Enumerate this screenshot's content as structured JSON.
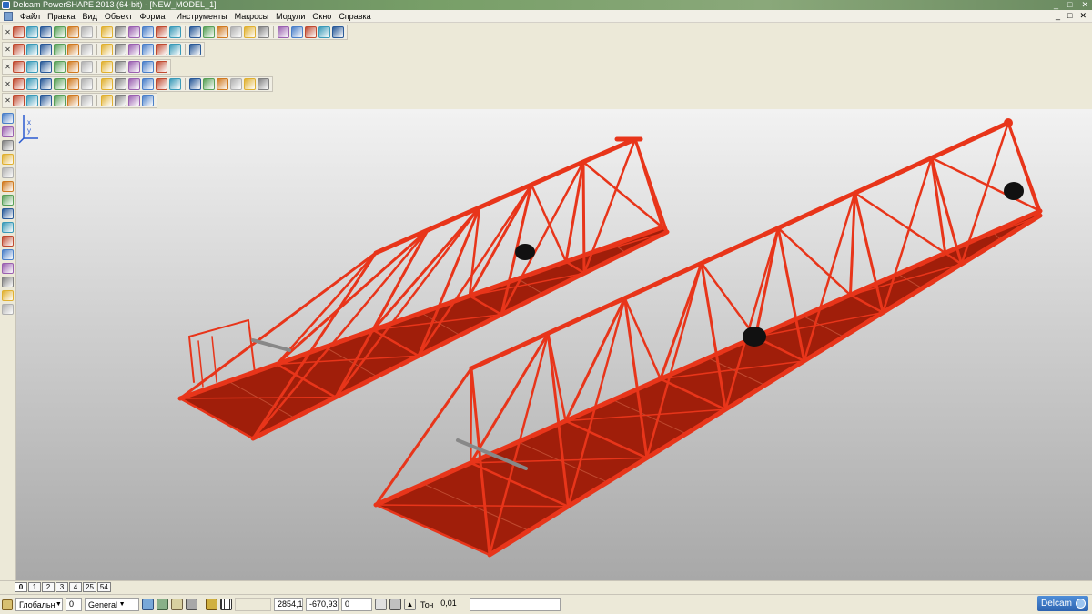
{
  "window": {
    "title": "Delcam PowerSHAPE 2013 (64-bit) - [NEW_MODEL_1]",
    "controls": [
      "_",
      "□",
      "✕"
    ]
  },
  "menubar": {
    "items": [
      "Файл",
      "Правка",
      "Вид",
      "Объект",
      "Формат",
      "Инструменты",
      "Макросы",
      "Модули",
      "Окно",
      "Справка"
    ],
    "mdi_controls": [
      "_",
      "□",
      "✕"
    ]
  },
  "toolbars": {
    "row1_icons": [
      "open-icon",
      "folder-icon",
      "save-icon",
      "print-icon",
      "disk-icon",
      "cut-icon",
      "copy-icon",
      "paste-icon",
      "delete-icon",
      "erase-icon",
      "undo-icon",
      "redo-icon",
      "edit-icon",
      "transform-icon",
      "move-icon",
      "rotate-icon",
      "circle-icon",
      "curve-icon",
      "text-icon",
      "brush-icon",
      "shade-icon",
      "wireframe-icon",
      "tools-icon"
    ],
    "row2_icons": [
      "view-front-icon",
      "view-iso-icon",
      "view-top-icon",
      "box-icon",
      "zoom-icon",
      "pan-icon",
      "zoom-in-icon",
      "zoom-out-icon",
      "globe-icon",
      "shade-mode-icon",
      "render-icon",
      "light-icon",
      "hand-icon"
    ],
    "row3_icons": [
      "layer-icon",
      "doc-icon",
      "paint-icon",
      "sphere-icon",
      "red-ball-icon",
      "play-icon",
      "arrow-icon",
      "cube-icon",
      "grid-icon",
      "measure-icon",
      "tree-icon"
    ],
    "row4_icons": [
      "select-icon",
      "box-select-icon",
      "solid-icon",
      "sphere-solid-icon",
      "cone-icon",
      "cylinder-icon",
      "torus-icon",
      "wedge-icon",
      "shell-icon",
      "boolean-icon",
      "fillet-icon",
      "chamfer-icon",
      "extrude-icon",
      "revolve-icon",
      "sweep-icon",
      "loft-icon",
      "draft-icon",
      "mirror-icon"
    ],
    "row5_icons": [
      "surface-icon",
      "curve-edit-icon",
      "mesh-icon",
      "point-icon",
      "patch-icon",
      "offset-icon",
      "trim-icon",
      "blend-icon",
      "ruler-icon",
      "arrow-blue-icon"
    ]
  },
  "left_toolbar_icons": [
    "pointer-icon",
    "select-group-icon",
    "copy-obj-icon",
    "layer-obj-icon",
    "group-icon",
    "solid-tool-icon",
    "surface-tool-icon",
    "cylinder-tool-icon",
    "wireframe-tool-icon",
    "box-tool-icon",
    "feature-icon",
    "shell-tool-icon",
    "mesh-tool-icon",
    "blend-tool-icon",
    "globe-tool-icon"
  ],
  "layer_tabs": [
    "0",
    "1",
    "2",
    "3",
    "4",
    "25",
    "54"
  ],
  "statusbar": {
    "workplane": "Глобальн",
    "level_num": "0",
    "level_name": "General",
    "coord_x": "2854,1",
    "coord_y": "-670,93",
    "coord_z": "0",
    "tol_label": "Точ",
    "tol_value": "0,01",
    "logo": "Delcam"
  },
  "colors": {
    "model_red": "#e8351a",
    "model_dark": "#a01e0a",
    "viewport_top": "#f2f2f2",
    "viewport_bottom": "#a8a8a8"
  }
}
